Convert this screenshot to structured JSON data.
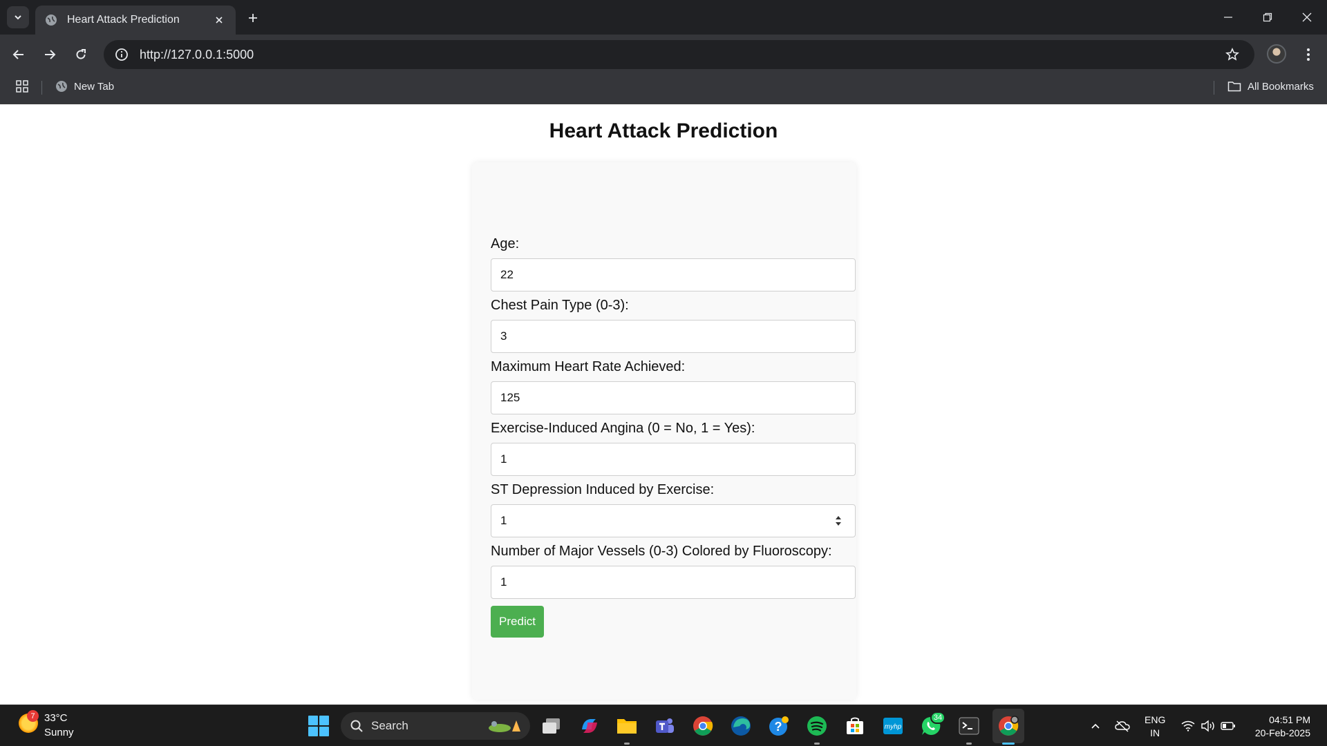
{
  "browser": {
    "tab_title": "Heart Attack Prediction",
    "url": "http://127.0.0.1:5000",
    "bookmarks": {
      "new_tab_label": "New Tab",
      "all_bookmarks_label": "All Bookmarks"
    }
  },
  "page": {
    "title": "Heart Attack Prediction",
    "fields": [
      {
        "label": "Age:",
        "value": "22"
      },
      {
        "label": "Chest Pain Type (0-3):",
        "value": "3"
      },
      {
        "label": "Maximum Heart Rate Achieved:",
        "value": "125"
      },
      {
        "label": "Exercise-Induced Angina (0 = No, 1 = Yes):",
        "value": "1"
      },
      {
        "label": "ST Depression Induced by Exercise:",
        "value": "1"
      },
      {
        "label": "Number of Major Vessels (0-3) Colored by Fluoroscopy:",
        "value": "1"
      }
    ],
    "submit_label": "Predict",
    "accent_color": "#4caf50"
  },
  "taskbar": {
    "weather": {
      "temp": "33°C",
      "condition": "Sunny",
      "badge": "7"
    },
    "search_label": "Search",
    "whatsapp_badge": "34",
    "language": {
      "line1": "ENG",
      "line2": "IN"
    },
    "clock": {
      "time": "04:51 PM",
      "date": "20-Feb-2025"
    }
  }
}
